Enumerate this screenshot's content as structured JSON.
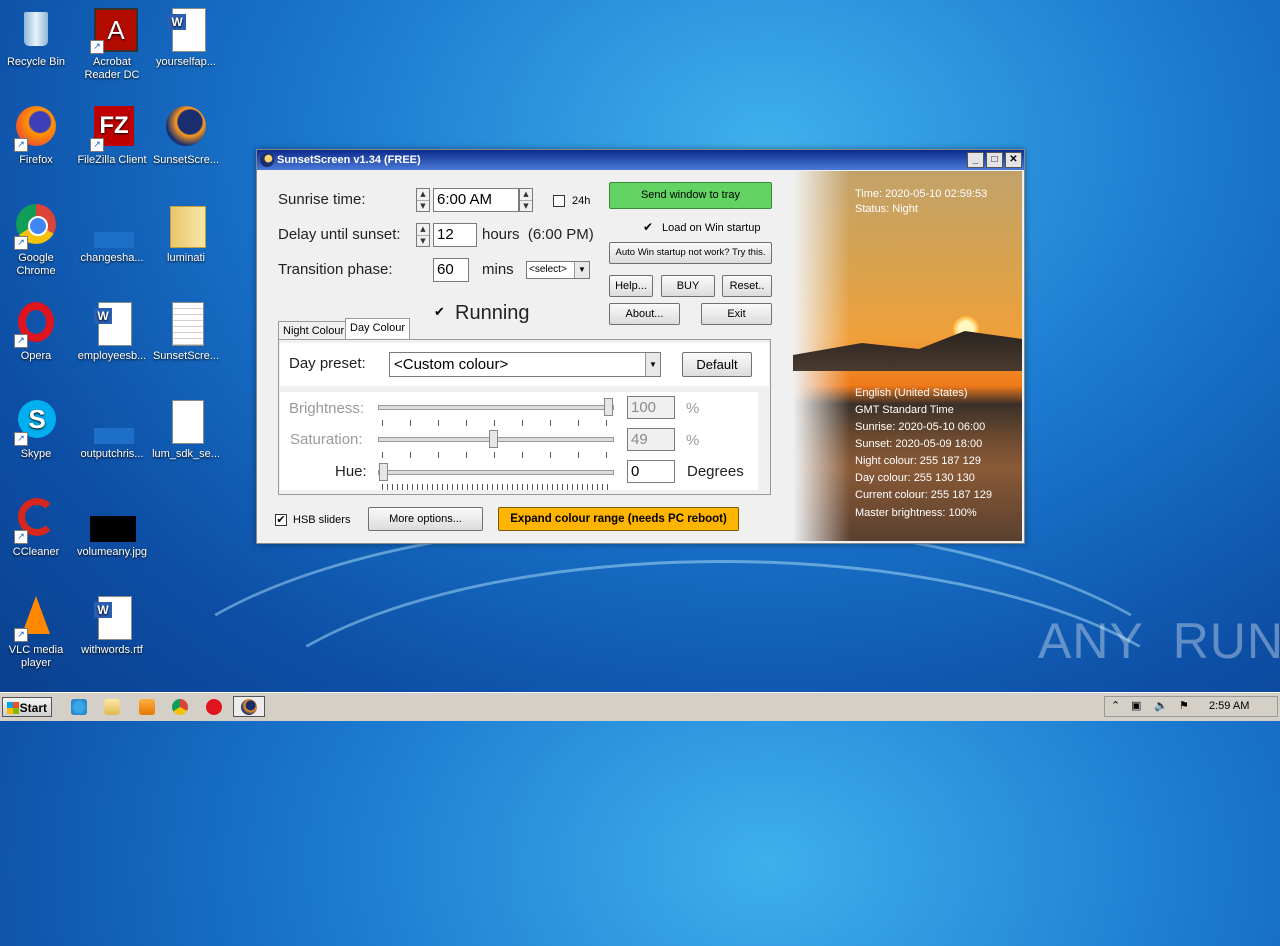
{
  "desktop": {
    "icons": [
      {
        "label": "Recycle Bin"
      },
      {
        "label": "Acrobat\nReader DC"
      },
      {
        "label": "yourselfap..."
      },
      {
        "label": "Firefox"
      },
      {
        "label": "FileZilla Client"
      },
      {
        "label": "SunsetScre..."
      },
      {
        "label": "Google\nChrome"
      },
      {
        "label": "changesha..."
      },
      {
        "label": "luminati"
      },
      {
        "label": "Opera"
      },
      {
        "label": "employeesb..."
      },
      {
        "label": "SunsetScre..."
      },
      {
        "label": "Skype"
      },
      {
        "label": "outputchris..."
      },
      {
        "label": "lum_sdk_se..."
      },
      {
        "label": "CCleaner"
      },
      {
        "label": "volumeany.jpg"
      },
      {
        "label": "VLC media\nplayer"
      },
      {
        "label": "withwords.rtf"
      }
    ],
    "watermark": "ANY  RUN"
  },
  "window": {
    "title": "SunsetScreen v1.34 (FREE)",
    "sunrise_label": "Sunrise time:",
    "sunrise_value": "6:00 AM",
    "h24_label": "24h",
    "delay_label": "Delay until sunset:",
    "delay_value": "12",
    "delay_suffix": "hours  (6:00 PM)",
    "transition_label": "Transition phase:",
    "transition_value": "60",
    "transition_unit": "mins",
    "transition_select": "<select>",
    "running_label": "Running",
    "send_tray": "Send window to tray",
    "load_startup": "Load on Win startup",
    "auto_startup": "Auto Win startup not work? Try this.",
    "help": "Help...",
    "buy": "BUY",
    "reset": "Reset..",
    "about": "About...",
    "exit": "Exit",
    "tabs": [
      "Night Colour",
      "Day Colour"
    ],
    "day_preset_label": "Day preset:",
    "day_preset_value": "<Custom colour>",
    "default_btn": "Default",
    "brightness_label": "Brightness:",
    "brightness_value": "100",
    "saturation_label": "Saturation:",
    "saturation_value": "49",
    "hue_label": "Hue:",
    "hue_value": "0",
    "percent": "%",
    "degrees": "Degrees",
    "hsb_sliders": "HSB sliders",
    "more_options": "More options...",
    "expand_range": "Expand colour range (needs PC reboot)",
    "info_top": [
      "Time: 2020-05-10 02:59:53",
      "Status: Night"
    ],
    "info_bottom": [
      "English (United States)",
      "GMT Standard Time",
      "Sunrise: 2020-05-10 06:00",
      "Sunset: 2020-05-09 18:00",
      "Night colour: 255 187 129",
      "Day colour: 255 130 130",
      "Current colour: 255 187 129",
      "Master brightness: 100%"
    ]
  },
  "taskbar": {
    "start": "Start",
    "clock": "2:59 AM"
  },
  "colors": {
    "accent_green": "#63d463",
    "expand_orange": "#ffb400"
  }
}
